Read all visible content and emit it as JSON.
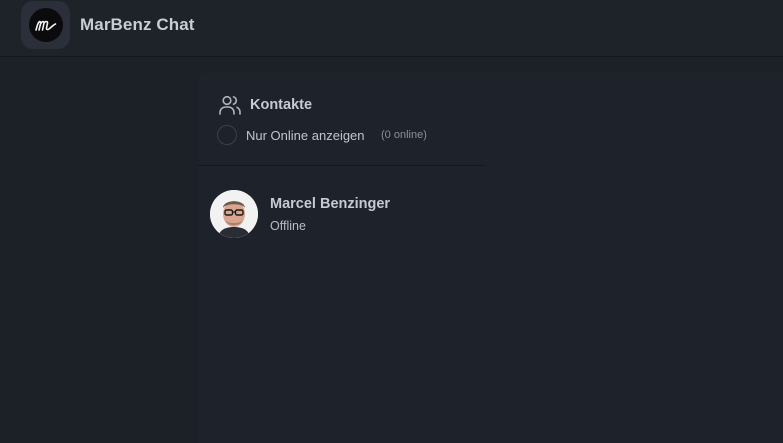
{
  "header": {
    "app_title": "MarBenz Chat",
    "logo_icon": "marbenz-m-logo"
  },
  "contacts_panel": {
    "title": "Kontakte",
    "title_icon": "users-icon",
    "online_filter": {
      "label": "Nur Online anzeigen",
      "count_text": "(0 online)",
      "checked": false
    },
    "contacts": [
      {
        "name": "Marcel Benzinger",
        "status": "Offline",
        "avatar_icon": "user-avatar"
      }
    ]
  },
  "colors": {
    "background": "#1c2027",
    "topbar": "#1e2229",
    "panel": "#1e222a",
    "logo_tile": "#2a2f3a",
    "text_primary": "#c6cbd3",
    "text_muted": "#8a909a"
  }
}
